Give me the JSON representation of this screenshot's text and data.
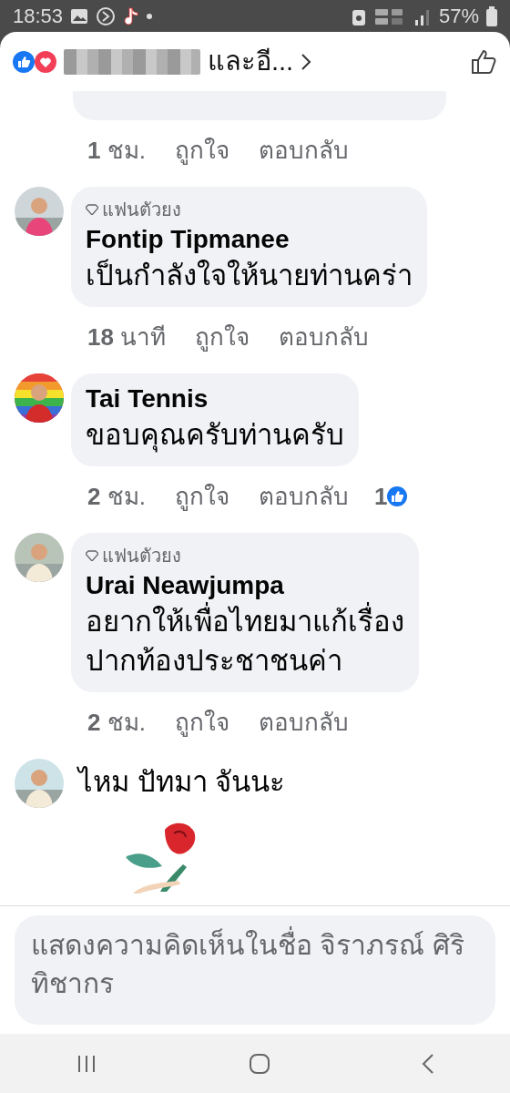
{
  "status_bar": {
    "time": "18:53",
    "battery": "57%"
  },
  "reactions_header": {
    "names_suffix": "และอี..."
  },
  "comments": [
    {
      "kind": "cut",
      "time": "**1** ชม.",
      "like": "ถูกใจ",
      "reply": "ตอบกลับ"
    },
    {
      "kind": "bubble",
      "badge": "แฟนตัวยง",
      "author": "Fontip Tipmanee",
      "lines": [
        "เป็นกำลังใจให้นายท่านคร่า"
      ],
      "time": "**18** นาที",
      "like": "ถูกใจ",
      "reply": "ตอบกลับ"
    },
    {
      "kind": "bubble",
      "author": "Tai Tennis",
      "lines": [
        "ขอบคุณครับท่านครับ"
      ],
      "time": "**2** ชม.",
      "like": "ถูกใจ",
      "reply": "ตอบกลับ",
      "reaction_count": "1"
    },
    {
      "kind": "bubble",
      "badge": "แฟนตัวยง",
      "author": "Urai Neawjumpa",
      "lines": [
        "อยากให้เพื่อไทยมาแก้เรื่อง",
        "ปากท้องประชาชนค่า"
      ],
      "time": "**2** ชม.",
      "like": "ถูกใจ",
      "reply": "ตอบกลับ"
    },
    {
      "kind": "sticker",
      "author": "ไหม ปัทมา จันนะ"
    }
  ],
  "comment_field": {
    "placeholder": "แสดงความคิดเห็นในชื่อ จิราภรณ์ ศิริทิชากร"
  }
}
